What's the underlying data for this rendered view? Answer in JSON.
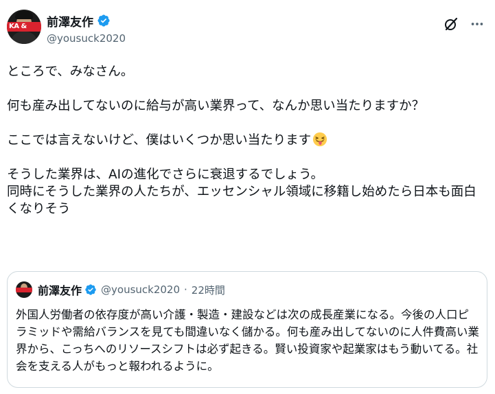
{
  "author": {
    "name": "前澤友作",
    "handle": "@yousuck2020",
    "avatar_badge_text": "KA  &"
  },
  "tweet": {
    "lines": [
      "ところで、みなさん。",
      "何も産み出してないのに給与が高い業界って、なんか思い当たりますか？",
      "ここでは言えないけど、僕はいくつか思い当たります",
      "そうした業界は、AIの進化でさらに衰退するでしょう。\n同時にそうした業界の人たちが、エッセンシャル領域に移籍し始めたら日本も面白くなりそう"
    ],
    "emoji": "squinting-tongue-face"
  },
  "quote": {
    "name": "前澤友作",
    "handle": "@yousuck2020",
    "separator": "·",
    "time": "22時間",
    "text": "外国人労働者の依存度が高い介護・製造・建設などは次の成長産業になる。今後の人口ピラミッドや需給バランスを見ても間違いなく儲かる。何も産み出してないのに人件費高い業界から、こっちへのリソースシフトは必ず起きる。賢い投資家や起業家はもう動いてる。社会を支える人がもっと報われるように。"
  },
  "icons": {
    "verified_color": "#1d9bf0",
    "grok": "grok-icon",
    "more": "more-icon"
  }
}
